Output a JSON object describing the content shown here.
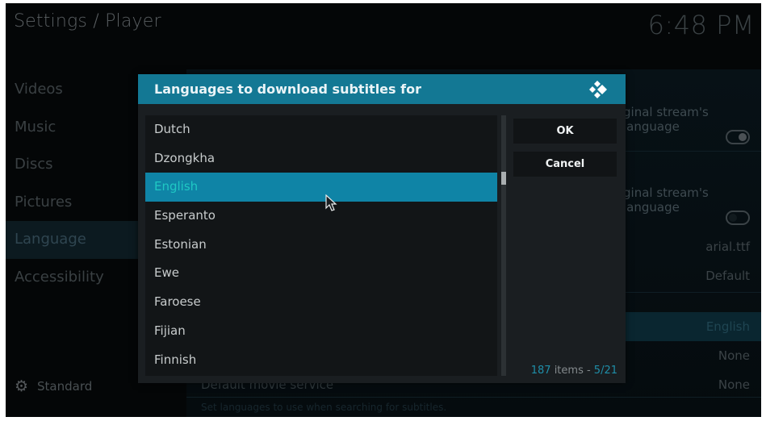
{
  "header": {
    "title": "Settings / Player",
    "clock": "6:48 PM"
  },
  "sidebar": {
    "items": [
      {
        "label": "Videos"
      },
      {
        "label": "Music"
      },
      {
        "label": "Discs"
      },
      {
        "label": "Pictures"
      },
      {
        "label": "Language",
        "active": true
      },
      {
        "label": "Accessibility"
      }
    ],
    "profile": {
      "icon": "gear-icon",
      "label": "Standard"
    }
  },
  "settings": {
    "rows": [
      {
        "label": "…original stream's language",
        "value": "",
        "toggle": "on"
      },
      {
        "label": "…original stream's language",
        "value": "",
        "toggle": "off"
      },
      {
        "label": "",
        "value": "arial.ttf"
      },
      {
        "label": "",
        "value": "Default"
      },
      {
        "label": "",
        "value": "English",
        "highlight": true
      },
      {
        "label": "",
        "value": "None"
      },
      {
        "label": "Default movie service",
        "value": "None"
      }
    ],
    "visible_label_fragment": "ginal stream's language",
    "help_text": "Set languages to use when searching for subtitles."
  },
  "dialog": {
    "title": "Languages to download subtitles for",
    "logo_icon": "kodi-logo-icon",
    "items": [
      {
        "label": "Dutch"
      },
      {
        "label": "Dzongkha"
      },
      {
        "label": "English",
        "selected": true
      },
      {
        "label": "Esperanto"
      },
      {
        "label": "Estonian"
      },
      {
        "label": "Ewe"
      },
      {
        "label": "Faroese"
      },
      {
        "label": "Fijian"
      },
      {
        "label": "Finnish"
      }
    ],
    "ok_label": "OK",
    "cancel_label": "Cancel",
    "counter": {
      "count": "187",
      "items_label": " items - ",
      "page": "5/21"
    },
    "accent_color": "#137894",
    "selected_color": "#0f84a6"
  }
}
